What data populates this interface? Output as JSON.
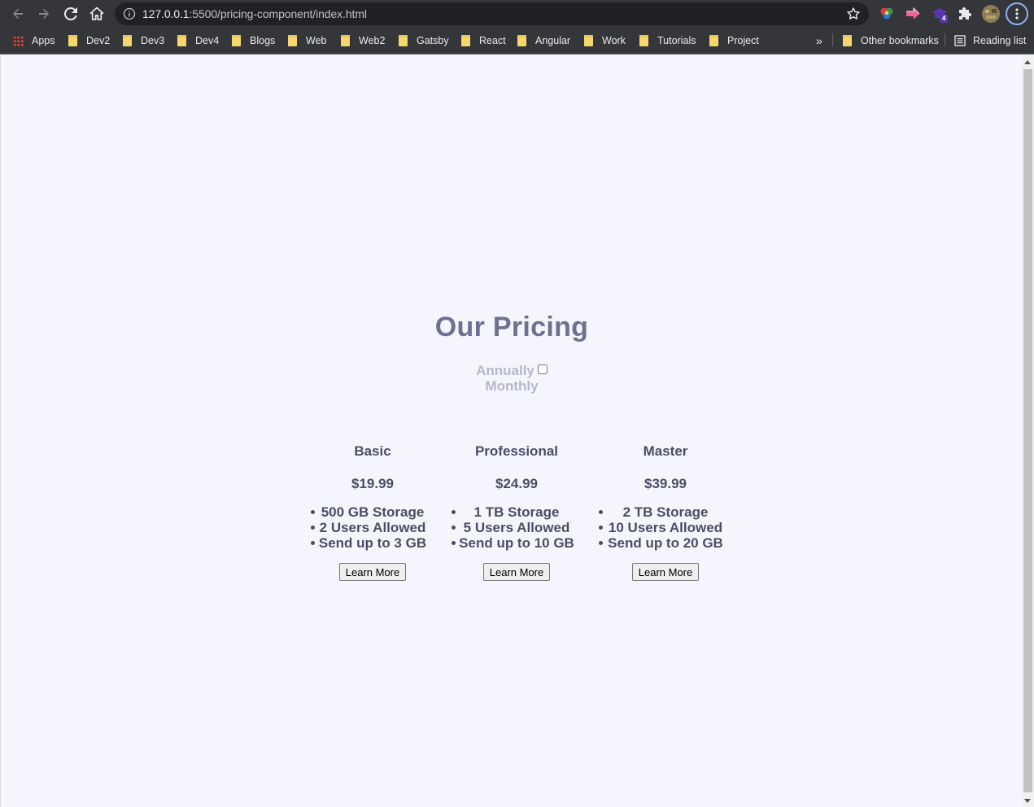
{
  "browser": {
    "url_host": "127.0.0.1",
    "url_path": ":5500/pricing-component/index.html",
    "bookmarks": [
      {
        "label": "Apps",
        "kind": "apps"
      },
      {
        "label": "Dev2",
        "kind": "folder"
      },
      {
        "label": "Dev3",
        "kind": "folder"
      },
      {
        "label": "Dev4",
        "kind": "folder"
      },
      {
        "label": "Blogs",
        "kind": "folder"
      },
      {
        "label": "Web",
        "kind": "folder"
      },
      {
        "label": "Web2",
        "kind": "folder"
      },
      {
        "label": "Gatsby",
        "kind": "folder"
      },
      {
        "label": "React",
        "kind": "folder"
      },
      {
        "label": "Angular",
        "kind": "folder"
      },
      {
        "label": "Work",
        "kind": "folder"
      },
      {
        "label": "Tutorials",
        "kind": "folder"
      },
      {
        "label": "Project",
        "kind": "folder"
      }
    ],
    "overflow_label": "»",
    "other_bookmarks": "Other bookmarks",
    "reading_list": "Reading list",
    "extension_badge": "4"
  },
  "page": {
    "title": "Our Pricing",
    "toggle": {
      "annually_label": "Annually",
      "monthly_label": "Monthly",
      "checked": false
    },
    "plans": [
      {
        "name": "Basic",
        "price": "$19.99",
        "features": [
          "500 GB Storage",
          "2 Users Allowed",
          "Send up to 3 GB"
        ],
        "button": "Learn More"
      },
      {
        "name": "Professional",
        "price": "$24.99",
        "features": [
          "1 TB Storage",
          "5 Users Allowed",
          "Send up to 10 GB"
        ],
        "button": "Learn More"
      },
      {
        "name": "Master",
        "price": "$39.99",
        "features": [
          "2 TB Storage",
          "10 Users Allowed",
          "Send up to 20 GB"
        ],
        "button": "Learn More"
      }
    ]
  }
}
